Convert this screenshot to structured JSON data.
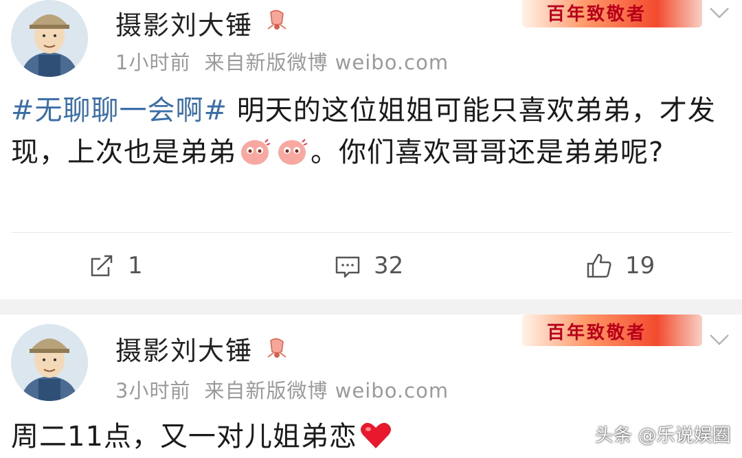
{
  "posts": [
    {
      "author": "摄影刘大锤",
      "time": "1小时前",
      "source": "来自新版微博 weibo.com",
      "banner_text": "百年致敬者",
      "hashtag": "#无聊聊一会啊#",
      "text_1": " 明天的这位姐姐可能只喜欢弟弟，才发现，上次也是弟弟",
      "text_2": "。你们喜欢哥哥还是弟弟呢?",
      "actions": {
        "repost": "1",
        "comment": "32",
        "like": "19"
      }
    },
    {
      "author": "摄影刘大锤",
      "time": "3小时前",
      "source": "来自新版微博 weibo.com",
      "banner_text": "百年致敬者",
      "text": "周二11点，又一对儿姐弟恋"
    }
  ],
  "watermark": "头条 @乐说娱圈",
  "colors": {
    "hashtag": "#3c6fa8",
    "meta": "#9a9a9a",
    "banner": "#f24b2e",
    "heart": "#e8192c"
  },
  "icons": [
    "bell-badge-icon",
    "chevron-down-icon",
    "repost-icon",
    "comment-icon",
    "like-icon",
    "blush-emoji-icon",
    "heart-icon"
  ]
}
